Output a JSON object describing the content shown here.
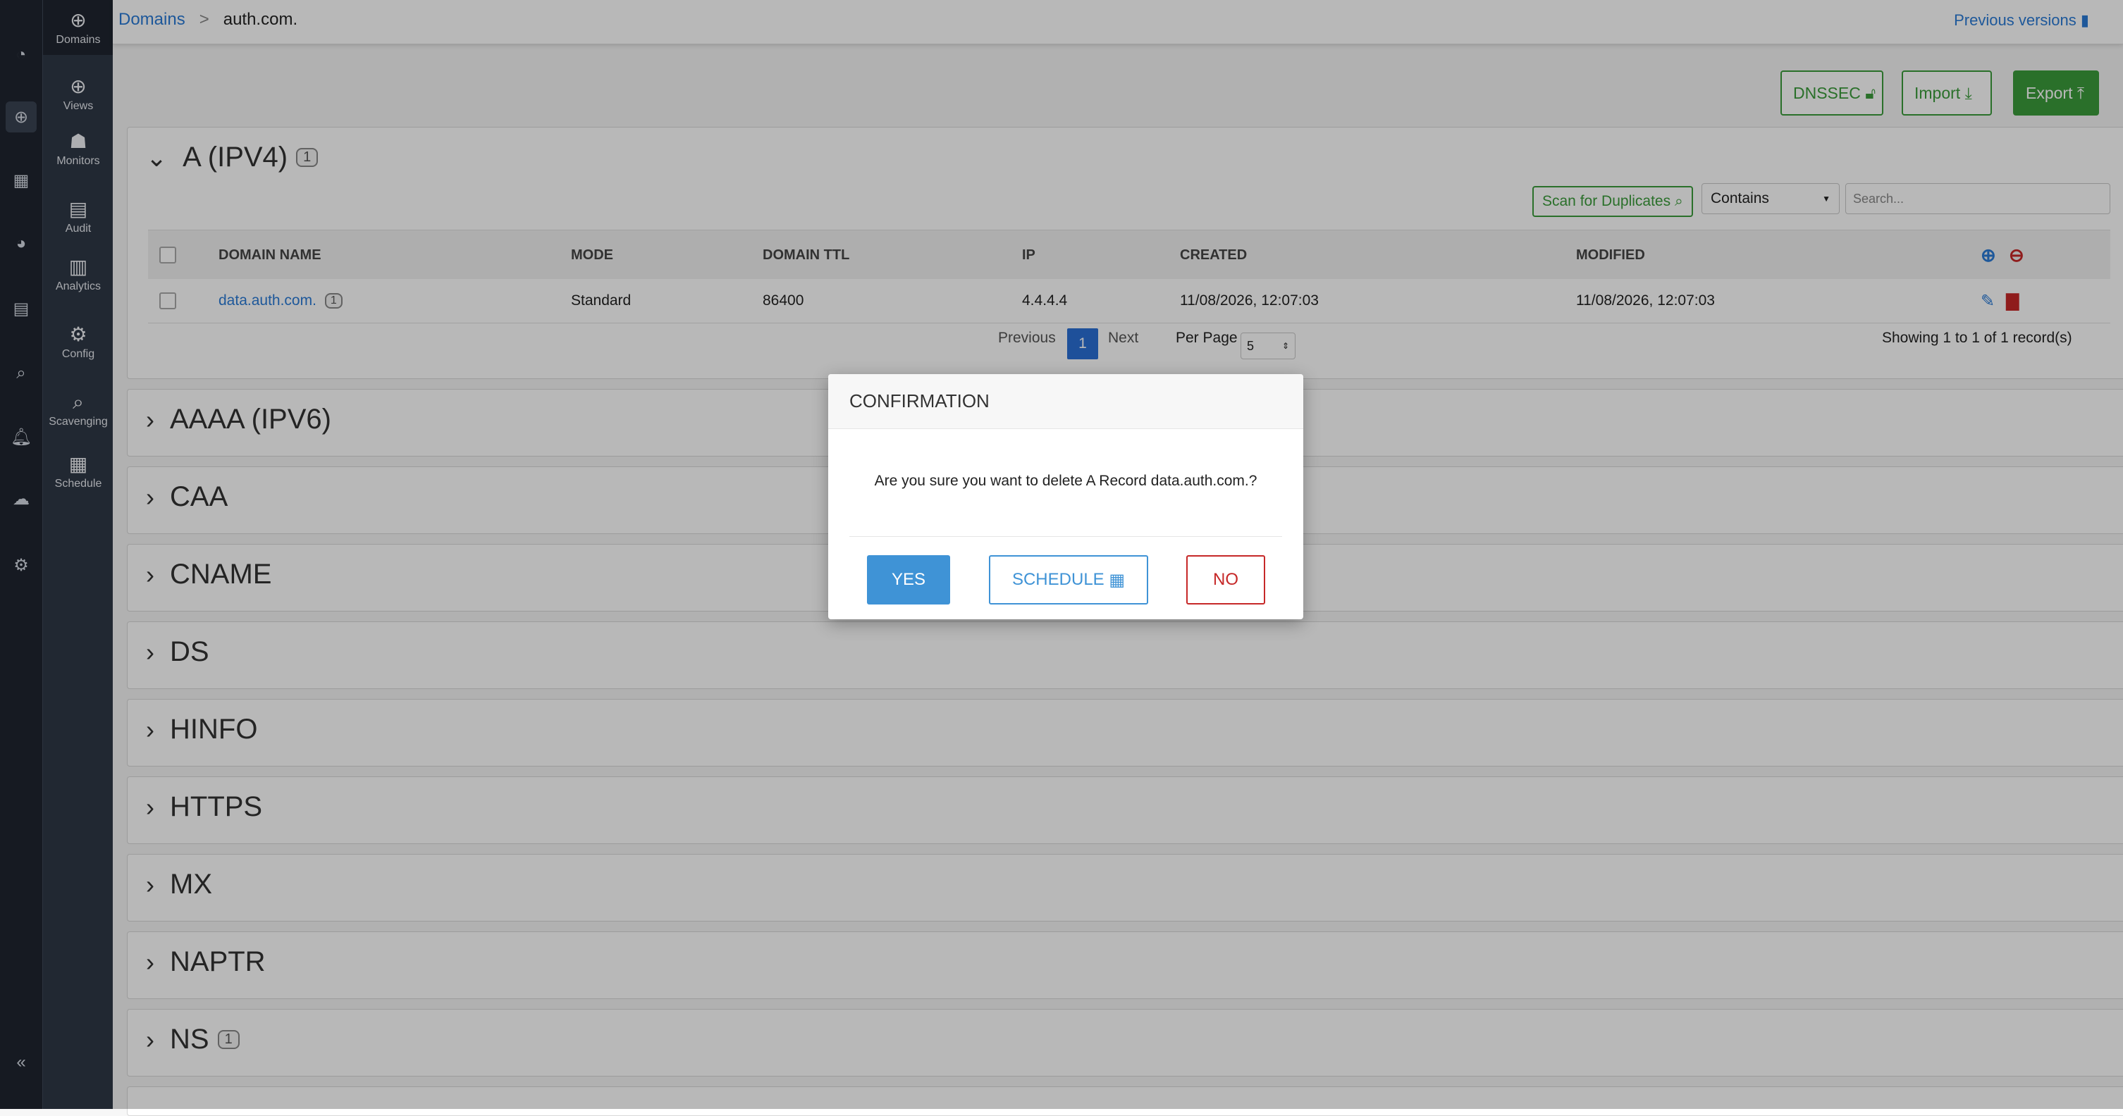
{
  "breadcrumb": {
    "parent": "Domains",
    "separator": ">",
    "current": "auth.com."
  },
  "previous_versions": "Previous versions",
  "nav": [
    {
      "label": "Domains",
      "icon": "domains-icon"
    },
    {
      "label": "Views",
      "icon": "views-icon"
    },
    {
      "label": "Monitors",
      "icon": "monitors-icon"
    },
    {
      "label": "Audit",
      "icon": "audit-icon"
    },
    {
      "label": "Analytics",
      "icon": "analytics-icon"
    },
    {
      "label": "Config",
      "icon": "config-icon"
    },
    {
      "label": "Scavenging",
      "icon": "scavenging-icon"
    },
    {
      "label": "Schedule",
      "icon": "schedule-icon"
    }
  ],
  "toolbar": {
    "dnssec": "DNSSEC",
    "import": "Import",
    "export": "Export"
  },
  "a_section": {
    "title": "A (IPV4)",
    "count": "1",
    "scan_label": "Scan for Duplicates",
    "filter_value": "Contains",
    "search_placeholder": "Search...",
    "columns": [
      "DOMAIN NAME",
      "MODE",
      "DOMAIN TTL",
      "IP",
      "CREATED",
      "MODIFIED"
    ],
    "rows": [
      {
        "domain": "data.auth.com.",
        "count": "1",
        "mode": "Standard",
        "ttl": "86400",
        "ip": "4.4.4.4",
        "created": "11/08/2026, 12:07:03",
        "modified": "11/08/2026, 12:07:03"
      }
    ],
    "pagination": {
      "previous": "Previous",
      "page": "1",
      "next": "Next",
      "per_page_label": "Per Page",
      "per_page": "5",
      "showing": "Showing 1 to 1 of 1 record(s)"
    }
  },
  "sections": [
    {
      "title": "AAAA (IPV6)"
    },
    {
      "title": "CAA"
    },
    {
      "title": "CNAME"
    },
    {
      "title": "DS"
    },
    {
      "title": "HINFO"
    },
    {
      "title": "HTTPS"
    },
    {
      "title": "MX"
    },
    {
      "title": "NAPTR"
    },
    {
      "title": "NS",
      "count": "1"
    }
  ],
  "modal": {
    "title": "CONFIRMATION",
    "message": "Are you sure you want to delete A Record data.auth.com.?",
    "yes": "YES",
    "schedule": "SCHEDULE",
    "no": "NO"
  },
  "colors": {
    "accent": "#2a7bd6",
    "green": "#3b9b3b",
    "danger": "#c62828",
    "primary_btn": "#3f93d6"
  }
}
